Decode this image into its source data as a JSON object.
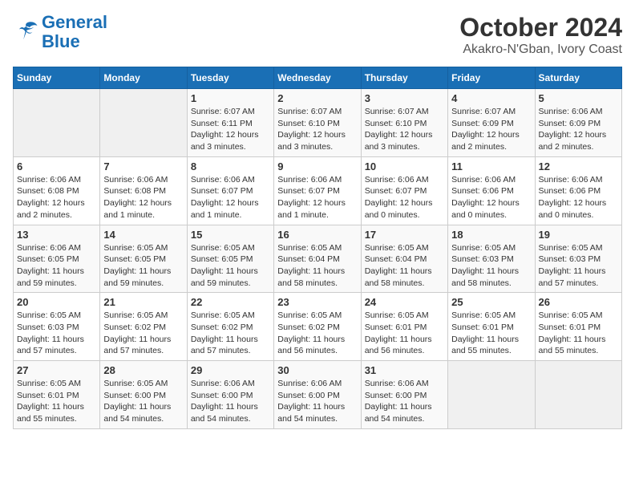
{
  "header": {
    "logo_line1": "General",
    "logo_line2": "Blue",
    "title": "October 2024",
    "subtitle": "Akakro-N'Gban, Ivory Coast"
  },
  "weekdays": [
    "Sunday",
    "Monday",
    "Tuesday",
    "Wednesday",
    "Thursday",
    "Friday",
    "Saturday"
  ],
  "weeks": [
    [
      {
        "day": "",
        "info": ""
      },
      {
        "day": "",
        "info": ""
      },
      {
        "day": "1",
        "info": "Sunrise: 6:07 AM\nSunset: 6:11 PM\nDaylight: 12 hours and 3 minutes."
      },
      {
        "day": "2",
        "info": "Sunrise: 6:07 AM\nSunset: 6:10 PM\nDaylight: 12 hours and 3 minutes."
      },
      {
        "day": "3",
        "info": "Sunrise: 6:07 AM\nSunset: 6:10 PM\nDaylight: 12 hours and 3 minutes."
      },
      {
        "day": "4",
        "info": "Sunrise: 6:07 AM\nSunset: 6:09 PM\nDaylight: 12 hours and 2 minutes."
      },
      {
        "day": "5",
        "info": "Sunrise: 6:06 AM\nSunset: 6:09 PM\nDaylight: 12 hours and 2 minutes."
      }
    ],
    [
      {
        "day": "6",
        "info": "Sunrise: 6:06 AM\nSunset: 6:08 PM\nDaylight: 12 hours and 2 minutes."
      },
      {
        "day": "7",
        "info": "Sunrise: 6:06 AM\nSunset: 6:08 PM\nDaylight: 12 hours and 1 minute."
      },
      {
        "day": "8",
        "info": "Sunrise: 6:06 AM\nSunset: 6:07 PM\nDaylight: 12 hours and 1 minute."
      },
      {
        "day": "9",
        "info": "Sunrise: 6:06 AM\nSunset: 6:07 PM\nDaylight: 12 hours and 1 minute."
      },
      {
        "day": "10",
        "info": "Sunrise: 6:06 AM\nSunset: 6:07 PM\nDaylight: 12 hours and 0 minutes."
      },
      {
        "day": "11",
        "info": "Sunrise: 6:06 AM\nSunset: 6:06 PM\nDaylight: 12 hours and 0 minutes."
      },
      {
        "day": "12",
        "info": "Sunrise: 6:06 AM\nSunset: 6:06 PM\nDaylight: 12 hours and 0 minutes."
      }
    ],
    [
      {
        "day": "13",
        "info": "Sunrise: 6:06 AM\nSunset: 6:05 PM\nDaylight: 11 hours and 59 minutes."
      },
      {
        "day": "14",
        "info": "Sunrise: 6:05 AM\nSunset: 6:05 PM\nDaylight: 11 hours and 59 minutes."
      },
      {
        "day": "15",
        "info": "Sunrise: 6:05 AM\nSunset: 6:05 PM\nDaylight: 11 hours and 59 minutes."
      },
      {
        "day": "16",
        "info": "Sunrise: 6:05 AM\nSunset: 6:04 PM\nDaylight: 11 hours and 58 minutes."
      },
      {
        "day": "17",
        "info": "Sunrise: 6:05 AM\nSunset: 6:04 PM\nDaylight: 11 hours and 58 minutes."
      },
      {
        "day": "18",
        "info": "Sunrise: 6:05 AM\nSunset: 6:03 PM\nDaylight: 11 hours and 58 minutes."
      },
      {
        "day": "19",
        "info": "Sunrise: 6:05 AM\nSunset: 6:03 PM\nDaylight: 11 hours and 57 minutes."
      }
    ],
    [
      {
        "day": "20",
        "info": "Sunrise: 6:05 AM\nSunset: 6:03 PM\nDaylight: 11 hours and 57 minutes."
      },
      {
        "day": "21",
        "info": "Sunrise: 6:05 AM\nSunset: 6:02 PM\nDaylight: 11 hours and 57 minutes."
      },
      {
        "day": "22",
        "info": "Sunrise: 6:05 AM\nSunset: 6:02 PM\nDaylight: 11 hours and 57 minutes."
      },
      {
        "day": "23",
        "info": "Sunrise: 6:05 AM\nSunset: 6:02 PM\nDaylight: 11 hours and 56 minutes."
      },
      {
        "day": "24",
        "info": "Sunrise: 6:05 AM\nSunset: 6:01 PM\nDaylight: 11 hours and 56 minutes."
      },
      {
        "day": "25",
        "info": "Sunrise: 6:05 AM\nSunset: 6:01 PM\nDaylight: 11 hours and 55 minutes."
      },
      {
        "day": "26",
        "info": "Sunrise: 6:05 AM\nSunset: 6:01 PM\nDaylight: 11 hours and 55 minutes."
      }
    ],
    [
      {
        "day": "27",
        "info": "Sunrise: 6:05 AM\nSunset: 6:01 PM\nDaylight: 11 hours and 55 minutes."
      },
      {
        "day": "28",
        "info": "Sunrise: 6:05 AM\nSunset: 6:00 PM\nDaylight: 11 hours and 54 minutes."
      },
      {
        "day": "29",
        "info": "Sunrise: 6:06 AM\nSunset: 6:00 PM\nDaylight: 11 hours and 54 minutes."
      },
      {
        "day": "30",
        "info": "Sunrise: 6:06 AM\nSunset: 6:00 PM\nDaylight: 11 hours and 54 minutes."
      },
      {
        "day": "31",
        "info": "Sunrise: 6:06 AM\nSunset: 6:00 PM\nDaylight: 11 hours and 54 minutes."
      },
      {
        "day": "",
        "info": ""
      },
      {
        "day": "",
        "info": ""
      }
    ]
  ]
}
